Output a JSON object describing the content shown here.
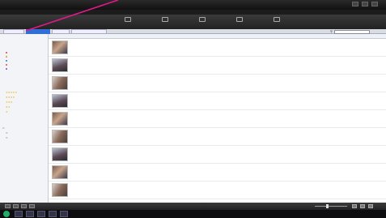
{
  "window": {
    "title": ""
  },
  "toolbar": {
    "buttons": [
      {
        "label": ""
      },
      {
        "label": ""
      },
      {
        "label": ""
      },
      {
        "label": ""
      },
      {
        "label": ""
      }
    ]
  },
  "tabs": [
    {
      "label": ""
    },
    {
      "label": ""
    },
    {
      "label": ""
    },
    {
      "label": ""
    }
  ],
  "search": {
    "placeholder": ""
  },
  "sidebar": {
    "sections": [
      {
        "label": ""
      },
      {
        "label": ""
      },
      {
        "label": ""
      }
    ],
    "items": [
      {
        "label": "",
        "color": "#e04a3a"
      },
      {
        "label": "",
        "color": "#e58a2a"
      },
      {
        "label": "",
        "color": "#2e7ad6"
      },
      {
        "label": "",
        "color": "#e04a3a"
      },
      {
        "label": "",
        "color": "#7a4ac6"
      }
    ],
    "ratings": [
      "★★★★★",
      "★★★★",
      "★★★",
      "★★",
      "★"
    ],
    "folders": [
      {
        "label": ""
      },
      {
        "label": ""
      },
      {
        "label": ""
      }
    ]
  },
  "columns": [
    {
      "label": ""
    },
    {
      "label": ""
    },
    {
      "label": ""
    },
    {
      "label": ""
    },
    {
      "label": ""
    },
    {
      "label": ""
    },
    {
      "label": ""
    },
    {
      "label": ""
    }
  ],
  "rows": [
    {
      "name": "",
      "type": "",
      "date1": "",
      "date2": "",
      "size": ""
    },
    {
      "name": "",
      "type": "",
      "date1": "",
      "date2": "",
      "size": ""
    },
    {
      "name": "",
      "type": "",
      "date1": "",
      "date2": "",
      "size": ""
    },
    {
      "name": "",
      "type": "",
      "date1": "",
      "date2": "",
      "size": ""
    },
    {
      "name": "",
      "type": "",
      "date1": "",
      "date2": "",
      "size": ""
    },
    {
      "name": "",
      "type": "",
      "date1": "",
      "date2": "",
      "size": ""
    },
    {
      "name": "",
      "type": "",
      "date1": "",
      "date2": "",
      "size": ""
    },
    {
      "name": "",
      "type": "",
      "date1": "",
      "date2": "",
      "size": ""
    },
    {
      "name": "",
      "type": "",
      "date1": "",
      "date2": "",
      "size": ""
    }
  ],
  "colors": {
    "accent": "#2f6fd6",
    "annotation": "#e0198a",
    "taskbar": "#0d0d10"
  }
}
